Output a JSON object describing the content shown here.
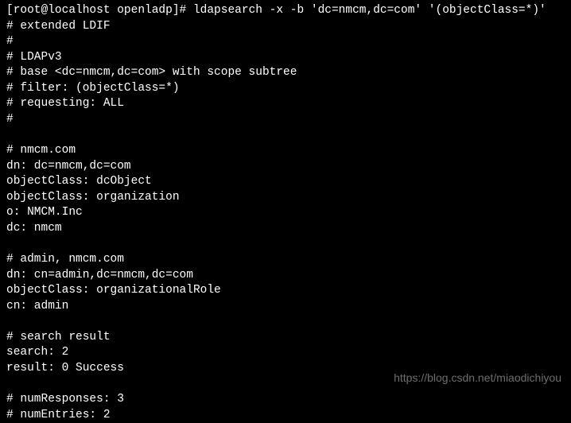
{
  "terminal": {
    "prompt": "[root@localhost openladp]# ",
    "command": "ldapsearch -x -b 'dc=nmcm,dc=com' '(objectClass=*)'",
    "lines": [
      "# extended LDIF",
      "#",
      "# LDAPv3",
      "# base <dc=nmcm,dc=com> with scope subtree",
      "# filter: (objectClass=*)",
      "# requesting: ALL",
      "#",
      "",
      "# nmcm.com",
      "dn: dc=nmcm,dc=com",
      "objectClass: dcObject",
      "objectClass: organization",
      "o: NMCM.Inc",
      "dc: nmcm",
      "",
      "# admin, nmcm.com",
      "dn: cn=admin,dc=nmcm,dc=com",
      "objectClass: organizationalRole",
      "cn: admin",
      "",
      "# search result",
      "search: 2",
      "result: 0 Success",
      "",
      "# numResponses: 3",
      "# numEntries: 2"
    ]
  },
  "watermark": "https://blog.csdn.net/miaodichiyou"
}
